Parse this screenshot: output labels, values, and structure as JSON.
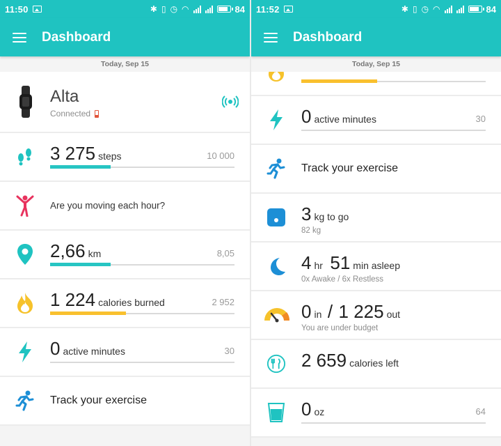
{
  "colors": {
    "teal": "#1fc3c1",
    "steps_fill": "#27c5c3",
    "calories_fill": "#f9c02e",
    "pink": "#e8335e",
    "blue": "#1d8fd6",
    "yellow": "#f6c22b"
  },
  "left": {
    "status": {
      "time": "11:50",
      "battery": "84"
    },
    "appbar": {
      "title": "Dashboard"
    },
    "date": "Today, Sep 15",
    "device": {
      "name": "Alta",
      "status": "Connected",
      "icon": "fitbit-band-icon"
    },
    "steps": {
      "value": "3 275",
      "unit": "steps",
      "goal": "10 000",
      "progress": 0.3275
    },
    "hourly": {
      "text": "Are you moving each hour?"
    },
    "distance": {
      "value": "2,66",
      "unit": "km",
      "goal": "8,05",
      "progress": 0.33
    },
    "calories": {
      "value": "1 224",
      "unit": "calories burned",
      "goal": "2 952",
      "progress": 0.41
    },
    "active": {
      "value": "0",
      "unit": "active minutes",
      "goal": "30"
    },
    "exercise": {
      "text": "Track your exercise"
    }
  },
  "right": {
    "status": {
      "time": "11:52",
      "battery": "84"
    },
    "appbar": {
      "title": "Dashboard"
    },
    "date": "Today, Sep 15",
    "active": {
      "value": "0",
      "unit": "active minutes",
      "goal": "30"
    },
    "exercise": {
      "text": "Track your exercise"
    },
    "weight": {
      "value": "3",
      "unit": "kg to go",
      "sub": "82 kg"
    },
    "sleep": {
      "hours": "4",
      "hr_unit": "hr",
      "minutes": "51",
      "min_unit": "min asleep",
      "sub": "0x Awake / 6x Restless"
    },
    "food": {
      "in_value": "0",
      "in_unit": "in",
      "slash": "/",
      "out_value": "1 225",
      "out_unit": "out",
      "sub": "You are under budget"
    },
    "calories_left": {
      "value": "2 659",
      "unit": "calories left"
    },
    "water": {
      "value": "0",
      "unit": "oz",
      "goal": "64"
    }
  }
}
